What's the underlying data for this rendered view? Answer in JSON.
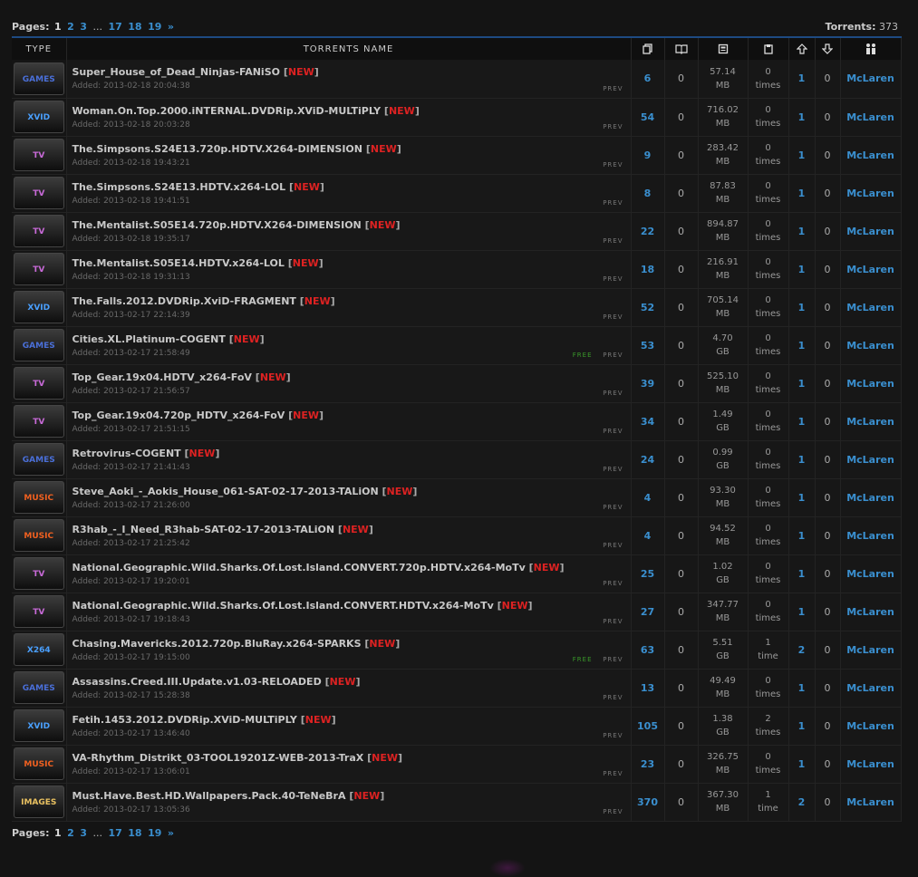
{
  "pager": {
    "label": "Pages:",
    "current": "1",
    "pages": [
      "2",
      "3"
    ],
    "ellipsis": "...",
    "tail_pages": [
      "17",
      "18",
      "19",
      "»"
    ],
    "torrents_label": "Torrents:",
    "torrents_count": "373"
  },
  "headers": {
    "type": "TYPE",
    "name": "TORRENTS NAME",
    "icons": [
      "files-icon",
      "comments-icon",
      "size-icon",
      "snatched-icon",
      "seeders-arrow-up-icon",
      "leechers-arrow-down-icon",
      "uploader-people-icon"
    ]
  },
  "category_colors": {
    "GAMES": "#4a6fd8",
    "XVID": "#4aa0ff",
    "TV": "#c86ad8",
    "MUSIC": "#f06020",
    "X264": "#4aa0ff",
    "IMAGES": "#e8c060"
  },
  "new_tag": "NEW",
  "prev_label": "PREV",
  "free_label": "FREE",
  "added_prefix": "Added: ",
  "rows": [
    {
      "cat": "GAMES",
      "name": "Super_House_of_Dead_Ninjas-FANiSO",
      "added": "2013-02-18 20:04:38",
      "free": false,
      "files": "6",
      "comments": "0",
      "size": "57.14",
      "unit": "MB",
      "snatched": "0",
      "snatched_unit": "times",
      "seeders": "1",
      "leechers": "0",
      "uploader": "McLaren"
    },
    {
      "cat": "XVID",
      "name": "Woman.On.Top.2000.iNTERNAL.DVDRip.XViD-MULTiPLY",
      "added": "2013-02-18 20:03:28",
      "free": false,
      "files": "54",
      "comments": "0",
      "size": "716.02",
      "unit": "MB",
      "snatched": "0",
      "snatched_unit": "times",
      "seeders": "1",
      "leechers": "0",
      "uploader": "McLaren"
    },
    {
      "cat": "TV",
      "name": "The.Simpsons.S24E13.720p.HDTV.X264-DIMENSION",
      "added": "2013-02-18 19:43:21",
      "free": false,
      "files": "9",
      "comments": "0",
      "size": "283.42",
      "unit": "MB",
      "snatched": "0",
      "snatched_unit": "times",
      "seeders": "1",
      "leechers": "0",
      "uploader": "McLaren"
    },
    {
      "cat": "TV",
      "name": "The.Simpsons.S24E13.HDTV.x264-LOL",
      "added": "2013-02-18 19:41:51",
      "free": false,
      "files": "8",
      "comments": "0",
      "size": "87.83",
      "unit": "MB",
      "snatched": "0",
      "snatched_unit": "times",
      "seeders": "1",
      "leechers": "0",
      "uploader": "McLaren"
    },
    {
      "cat": "TV",
      "name": "The.Mentalist.S05E14.720p.HDTV.X264-DIMENSION",
      "added": "2013-02-18 19:35:17",
      "free": false,
      "files": "22",
      "comments": "0",
      "size": "894.87",
      "unit": "MB",
      "snatched": "0",
      "snatched_unit": "times",
      "seeders": "1",
      "leechers": "0",
      "uploader": "McLaren"
    },
    {
      "cat": "TV",
      "name": "The.Mentalist.S05E14.HDTV.x264-LOL",
      "added": "2013-02-18 19:31:13",
      "free": false,
      "files": "18",
      "comments": "0",
      "size": "216.91",
      "unit": "MB",
      "snatched": "0",
      "snatched_unit": "times",
      "seeders": "1",
      "leechers": "0",
      "uploader": "McLaren"
    },
    {
      "cat": "XVID",
      "name": "The.Falls.2012.DVDRip.XviD-FRAGMENT",
      "added": "2013-02-17 22:14:39",
      "free": false,
      "files": "52",
      "comments": "0",
      "size": "705.14",
      "unit": "MB",
      "snatched": "0",
      "snatched_unit": "times",
      "seeders": "1",
      "leechers": "0",
      "uploader": "McLaren"
    },
    {
      "cat": "GAMES",
      "name": "Cities.XL.Platinum-COGENT",
      "added": "2013-02-17 21:58:49",
      "free": true,
      "files": "53",
      "comments": "0",
      "size": "4.70",
      "unit": "GB",
      "snatched": "0",
      "snatched_unit": "times",
      "seeders": "1",
      "leechers": "0",
      "uploader": "McLaren"
    },
    {
      "cat": "TV",
      "name": "Top_Gear.19x04.HDTV_x264-FoV",
      "added": "2013-02-17 21:56:57",
      "free": false,
      "files": "39",
      "comments": "0",
      "size": "525.10",
      "unit": "MB",
      "snatched": "0",
      "snatched_unit": "times",
      "seeders": "1",
      "leechers": "0",
      "uploader": "McLaren"
    },
    {
      "cat": "TV",
      "name": "Top_Gear.19x04.720p_HDTV_x264-FoV",
      "added": "2013-02-17 21:51:15",
      "free": false,
      "files": "34",
      "comments": "0",
      "size": "1.49",
      "unit": "GB",
      "snatched": "0",
      "snatched_unit": "times",
      "seeders": "1",
      "leechers": "0",
      "uploader": "McLaren"
    },
    {
      "cat": "GAMES",
      "name": "Retrovirus-COGENT",
      "added": "2013-02-17 21:41:43",
      "free": false,
      "files": "24",
      "comments": "0",
      "size": "0.99",
      "unit": "GB",
      "snatched": "0",
      "snatched_unit": "times",
      "seeders": "1",
      "leechers": "0",
      "uploader": "McLaren"
    },
    {
      "cat": "MUSIC",
      "name": "Steve_Aoki_-_Aokis_House_061-SAT-02-17-2013-TALiON",
      "added": "2013-02-17 21:26:00",
      "free": false,
      "files": "4",
      "comments": "0",
      "size": "93.30",
      "unit": "MB",
      "snatched": "0",
      "snatched_unit": "times",
      "seeders": "1",
      "leechers": "0",
      "uploader": "McLaren"
    },
    {
      "cat": "MUSIC",
      "name": "R3hab_-_I_Need_R3hab-SAT-02-17-2013-TALiON",
      "added": "2013-02-17 21:25:42",
      "free": false,
      "files": "4",
      "comments": "0",
      "size": "94.52",
      "unit": "MB",
      "snatched": "0",
      "snatched_unit": "times",
      "seeders": "1",
      "leechers": "0",
      "uploader": "McLaren"
    },
    {
      "cat": "TV",
      "name": "National.Geographic.Wild.Sharks.Of.Lost.Island.CONVERT.720p.HDTV.x264-MoTv",
      "added": "2013-02-17 19:20:01",
      "free": false,
      "files": "25",
      "comments": "0",
      "size": "1.02",
      "unit": "GB",
      "snatched": "0",
      "snatched_unit": "times",
      "seeders": "1",
      "leechers": "0",
      "uploader": "McLaren"
    },
    {
      "cat": "TV",
      "name": "National.Geographic.Wild.Sharks.Of.Lost.Island.CONVERT.HDTV.x264-MoTv",
      "added": "2013-02-17 19:18:43",
      "free": false,
      "files": "27",
      "comments": "0",
      "size": "347.77",
      "unit": "MB",
      "snatched": "0",
      "snatched_unit": "times",
      "seeders": "1",
      "leechers": "0",
      "uploader": "McLaren"
    },
    {
      "cat": "X264",
      "name": "Chasing.Mavericks.2012.720p.BluRay.x264-SPARKS",
      "added": "2013-02-17 19:15:00",
      "free": true,
      "files": "63",
      "comments": "0",
      "size": "5.51",
      "unit": "GB",
      "snatched": "1",
      "snatched_unit": "time",
      "seeders": "2",
      "leechers": "0",
      "uploader": "McLaren"
    },
    {
      "cat": "GAMES",
      "name": "Assassins.Creed.III.Update.v1.03-RELOADED",
      "added": "2013-02-17 15:28:38",
      "free": false,
      "files": "13",
      "comments": "0",
      "size": "49.49",
      "unit": "MB",
      "snatched": "0",
      "snatched_unit": "times",
      "seeders": "1",
      "leechers": "0",
      "uploader": "McLaren"
    },
    {
      "cat": "XVID",
      "name": "Fetih.1453.2012.DVDRip.XViD-MULTiPLY",
      "added": "2013-02-17 13:46:40",
      "free": false,
      "files": "105",
      "comments": "0",
      "size": "1.38",
      "unit": "GB",
      "snatched": "2",
      "snatched_unit": "times",
      "seeders": "1",
      "leechers": "0",
      "uploader": "McLaren"
    },
    {
      "cat": "MUSIC",
      "name": "VA-Rhythm_Distrikt_03-TOOL19201Z-WEB-2013-TraX",
      "added": "2013-02-17 13:06:01",
      "free": false,
      "files": "23",
      "comments": "0",
      "size": "326.75",
      "unit": "MB",
      "snatched": "0",
      "snatched_unit": "times",
      "seeders": "1",
      "leechers": "0",
      "uploader": "McLaren"
    },
    {
      "cat": "IMAGES",
      "name": "Must.Have.Best.HD.Wallpapers.Pack.40-TeNeBrA",
      "added": "2013-02-17 13:05:36",
      "free": false,
      "files": "370",
      "comments": "0",
      "size": "367.30",
      "unit": "MB",
      "snatched": "1",
      "snatched_unit": "time",
      "seeders": "2",
      "leechers": "0",
      "uploader": "McLaren"
    }
  ]
}
